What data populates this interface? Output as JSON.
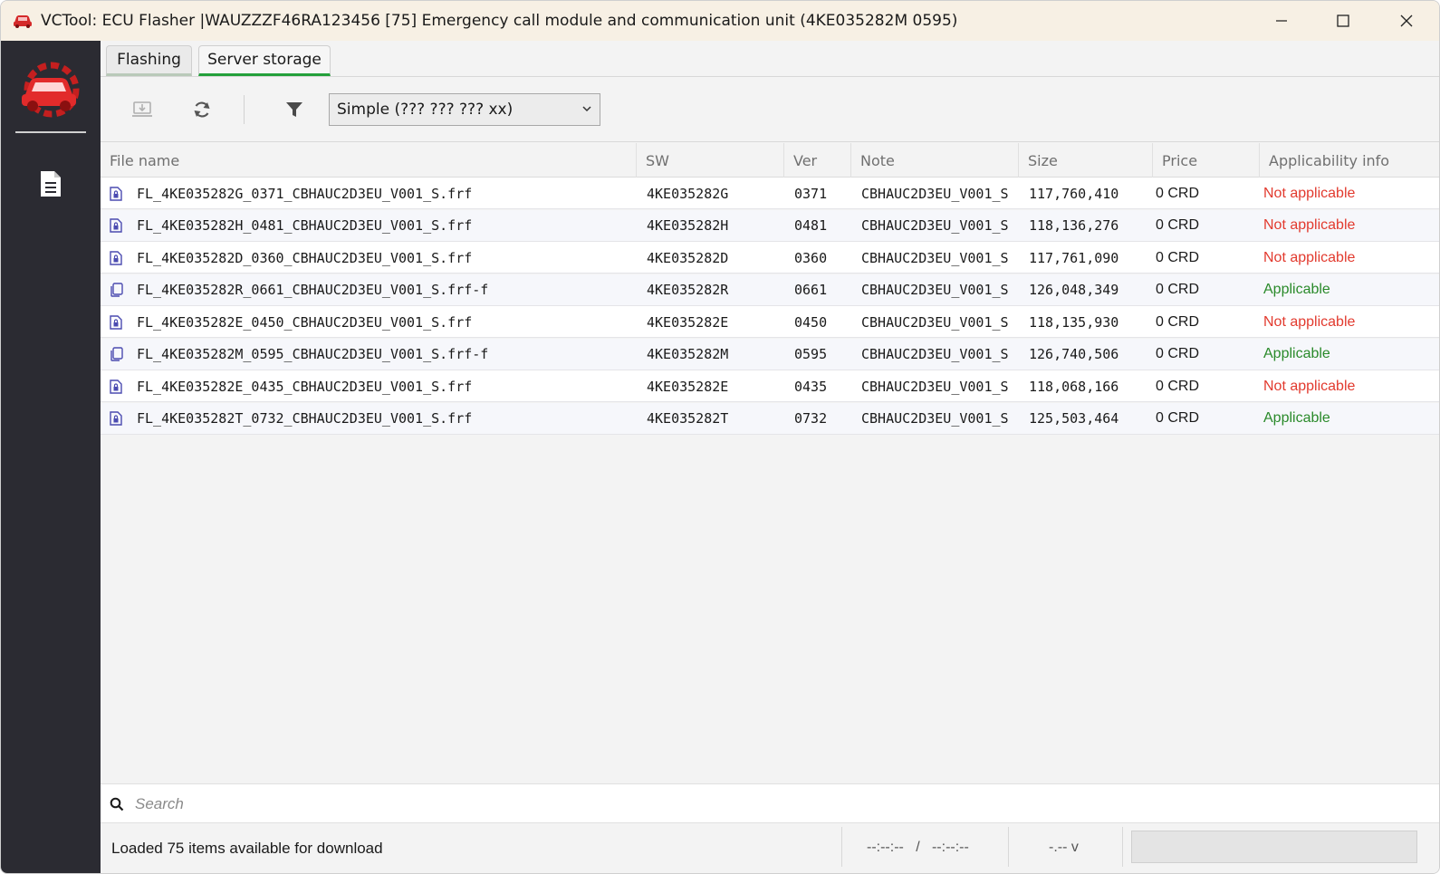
{
  "window": {
    "title": "VCTool: ECU Flasher |WAUZZZF46RA123456 [75] Emergency call module and communication unit (4KE035282M 0595)"
  },
  "tabs": [
    {
      "label": "Flashing",
      "active": false
    },
    {
      "label": "Server storage",
      "active": true
    }
  ],
  "toolbar": {
    "download_icon": "download-icon",
    "refresh_icon": "refresh-icon",
    "filter_icon": "filter-icon",
    "mode_selected": "Simple (??? ??? ??? xx)"
  },
  "table": {
    "columns": [
      "File name",
      "SW",
      "Ver",
      "Note",
      "Size",
      "Price",
      "Applicability info"
    ],
    "rows": [
      {
        "icon": "file-lock-icon",
        "file": "FL_4KE035282G_0371_CBHAUC2D3EU_V001_S.frf",
        "sw": "4KE035282G",
        "ver": "0371",
        "note": "CBHAUC2D3EU_V001_S",
        "size": "117,760,410",
        "price": "0 CRD",
        "app": "Not applicable",
        "applicable": false
      },
      {
        "icon": "file-lock-icon",
        "file": "FL_4KE035282H_0481_CBHAUC2D3EU_V001_S.frf",
        "sw": "4KE035282H",
        "ver": "0481",
        "note": "CBHAUC2D3EU_V001_S",
        "size": "118,136,276",
        "price": "0 CRD",
        "app": "Not applicable",
        "applicable": false
      },
      {
        "icon": "file-lock-icon",
        "file": "FL_4KE035282D_0360_CBHAUC2D3EU_V001_S.frf",
        "sw": "4KE035282D",
        "ver": "0360",
        "note": "CBHAUC2D3EU_V001_S",
        "size": "117,761,090",
        "price": "0 CRD",
        "app": "Not applicable",
        "applicable": false
      },
      {
        "icon": "file-copy-icon",
        "file": "FL_4KE035282R_0661_CBHAUC2D3EU_V001_S.frf-f",
        "sw": "4KE035282R",
        "ver": "0661",
        "note": "CBHAUC2D3EU_V001_S",
        "size": "126,048,349",
        "price": "0 CRD",
        "app": "Applicable",
        "applicable": true
      },
      {
        "icon": "file-lock-icon",
        "file": "FL_4KE035282E_0450_CBHAUC2D3EU_V001_S.frf",
        "sw": "4KE035282E",
        "ver": "0450",
        "note": "CBHAUC2D3EU_V001_S",
        "size": "118,135,930",
        "price": "0 CRD",
        "app": "Not applicable",
        "applicable": false
      },
      {
        "icon": "file-copy-icon",
        "file": "FL_4KE035282M_0595_CBHAUC2D3EU_V001_S.frf-f",
        "sw": "4KE035282M",
        "ver": "0595",
        "note": "CBHAUC2D3EU_V001_S",
        "size": "126,740,506",
        "price": "0 CRD",
        "app": "Applicable",
        "applicable": true
      },
      {
        "icon": "file-lock-icon",
        "file": "FL_4KE035282E_0435_CBHAUC2D3EU_V001_S.frf",
        "sw": "4KE035282E",
        "ver": "0435",
        "note": "CBHAUC2D3EU_V001_S",
        "size": "118,068,166",
        "price": "0 CRD",
        "app": "Not applicable",
        "applicable": false
      },
      {
        "icon": "file-lock-icon",
        "file": "FL_4KE035282T_0732_CBHAUC2D3EU_V001_S.frf",
        "sw": "4KE035282T",
        "ver": "0732",
        "note": "CBHAUC2D3EU_V001_S",
        "size": "125,503,464",
        "price": "0 CRD",
        "app": "Applicable",
        "applicable": true
      }
    ]
  },
  "search": {
    "placeholder": "Search"
  },
  "status": {
    "message": "Loaded 75 items available for download",
    "time": "--:--:--   /   --:--:--",
    "voltage": "-.-- v"
  },
  "colors": {
    "not_applicable": "#e23a2e",
    "applicable": "#2a8a2a",
    "active_tab_underline": "#23a03a",
    "brand_red": "#d42a2a",
    "sidebar_bg": "#2b2b32"
  }
}
